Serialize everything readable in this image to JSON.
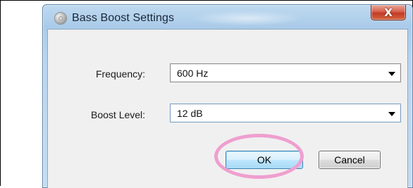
{
  "window": {
    "title": "Bass Boost Settings",
    "icon": "speaker-icon",
    "close_glyph": "X"
  },
  "form": {
    "frequency": {
      "label": "Frequency:",
      "value": "600 Hz"
    },
    "boost_level": {
      "label": "Boost Level:",
      "value": "12 dB"
    }
  },
  "buttons": {
    "ok_label": "OK",
    "cancel_label": "Cancel"
  },
  "colors": {
    "highlight_ring": "#ef9fcf",
    "close_button": "#c13c25",
    "default_button_border": "#3c7fb1"
  }
}
